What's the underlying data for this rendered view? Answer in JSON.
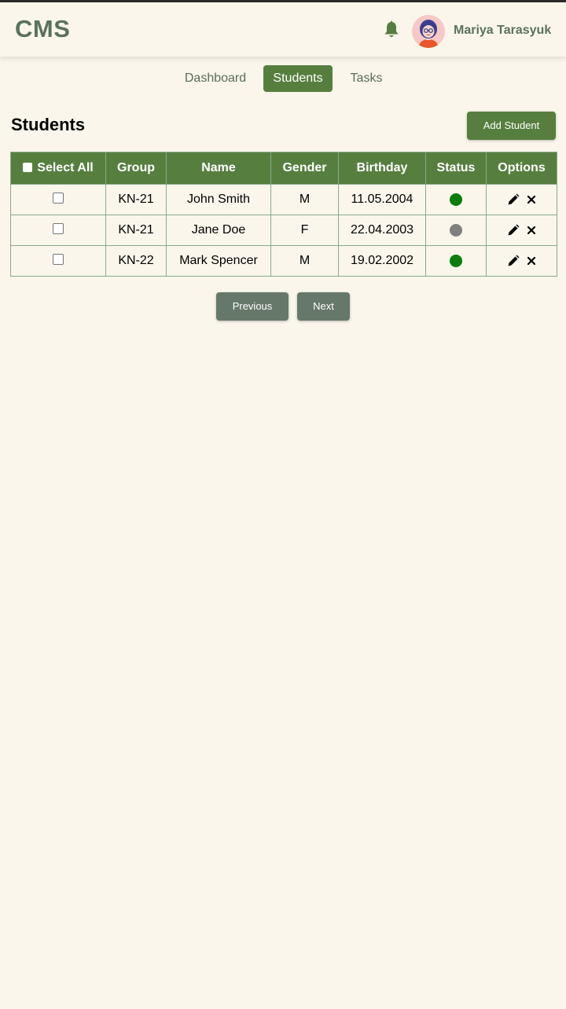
{
  "header": {
    "brand": "CMS",
    "user_name": "Mariya Tarasyuk",
    "icons": {
      "notifications": "bell-icon",
      "profile": "avatar"
    }
  },
  "nav": {
    "items": [
      {
        "label": "Dashboard",
        "active": false
      },
      {
        "label": "Students",
        "active": true
      },
      {
        "label": "Tasks",
        "active": false
      }
    ]
  },
  "page": {
    "title": "Students",
    "add_button": "Add Student"
  },
  "table": {
    "columns": [
      "Select All",
      "Group",
      "Name",
      "Gender",
      "Birthday",
      "Status",
      "Options"
    ],
    "rows": [
      {
        "checked": false,
        "group": "KN-21",
        "name": "John Smith",
        "gender": "M",
        "birthday": "11.05.2004",
        "status": "active"
      },
      {
        "checked": false,
        "group": "KN-21",
        "name": "Jane Doe",
        "gender": "F",
        "birthday": "22.04.2003",
        "status": "inactive"
      },
      {
        "checked": false,
        "group": "KN-22",
        "name": "Mark Spencer",
        "gender": "M",
        "birthday": "19.02.2002",
        "status": "active"
      }
    ],
    "option_icons": [
      "pencil-icon",
      "close-icon"
    ]
  },
  "pagination": {
    "previous": "Previous",
    "next": "Next"
  },
  "colors": {
    "accent": "#567f3f",
    "brand_text": "#5b7160",
    "background": "#faf6ec",
    "status_active": "#0b7d0b",
    "status_inactive": "#808080",
    "pager_button": "#66786a"
  }
}
